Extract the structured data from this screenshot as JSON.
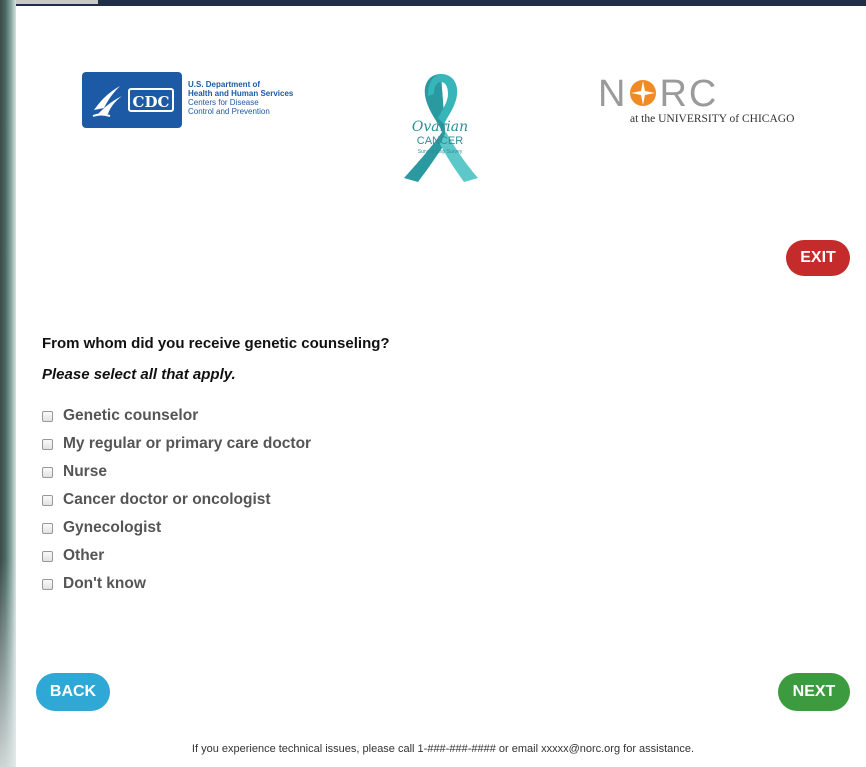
{
  "header": {
    "cdc_logo_text": "CDC",
    "hhs_lines": [
      "U.S. Department of",
      "Health and Human Services",
      "Centers for Disease",
      "Control and Prevention"
    ],
    "ribbon_lines": [
      "Ovarian",
      "CANCER",
      "Survivorship Survey"
    ],
    "norc_wordmark": [
      "N",
      "RC"
    ],
    "norc_sub": "at the UNIVERSITY of CHICAGO"
  },
  "exit_label": "EXIT",
  "question": {
    "text": "From whom did you receive genetic counseling?",
    "instruction": "Please select all that apply.",
    "options": [
      {
        "label": "Genetic counselor",
        "checked": false
      },
      {
        "label": "My regular or primary care doctor",
        "checked": false
      },
      {
        "label": "Nurse",
        "checked": false
      },
      {
        "label": "Cancer doctor or oncologist",
        "checked": false
      },
      {
        "label": "Gynecologist",
        "checked": false
      },
      {
        "label": "Other",
        "checked": false
      },
      {
        "label": "Don't know",
        "checked": false
      }
    ]
  },
  "nav": {
    "back_label": "BACK",
    "next_label": "NEXT"
  },
  "footer": {
    "support_text": "If you experience technical issues, please call 1-###-###-#### or email xxxxx@norc.org for assistance."
  },
  "colors": {
    "exit": "#c62b2b",
    "back": "#2fa8d6",
    "next": "#3c9b3f",
    "cdc_blue": "#1c5aa6",
    "ribbon_teal": "#2aa3a8",
    "norc_orange": "#f08a24"
  }
}
